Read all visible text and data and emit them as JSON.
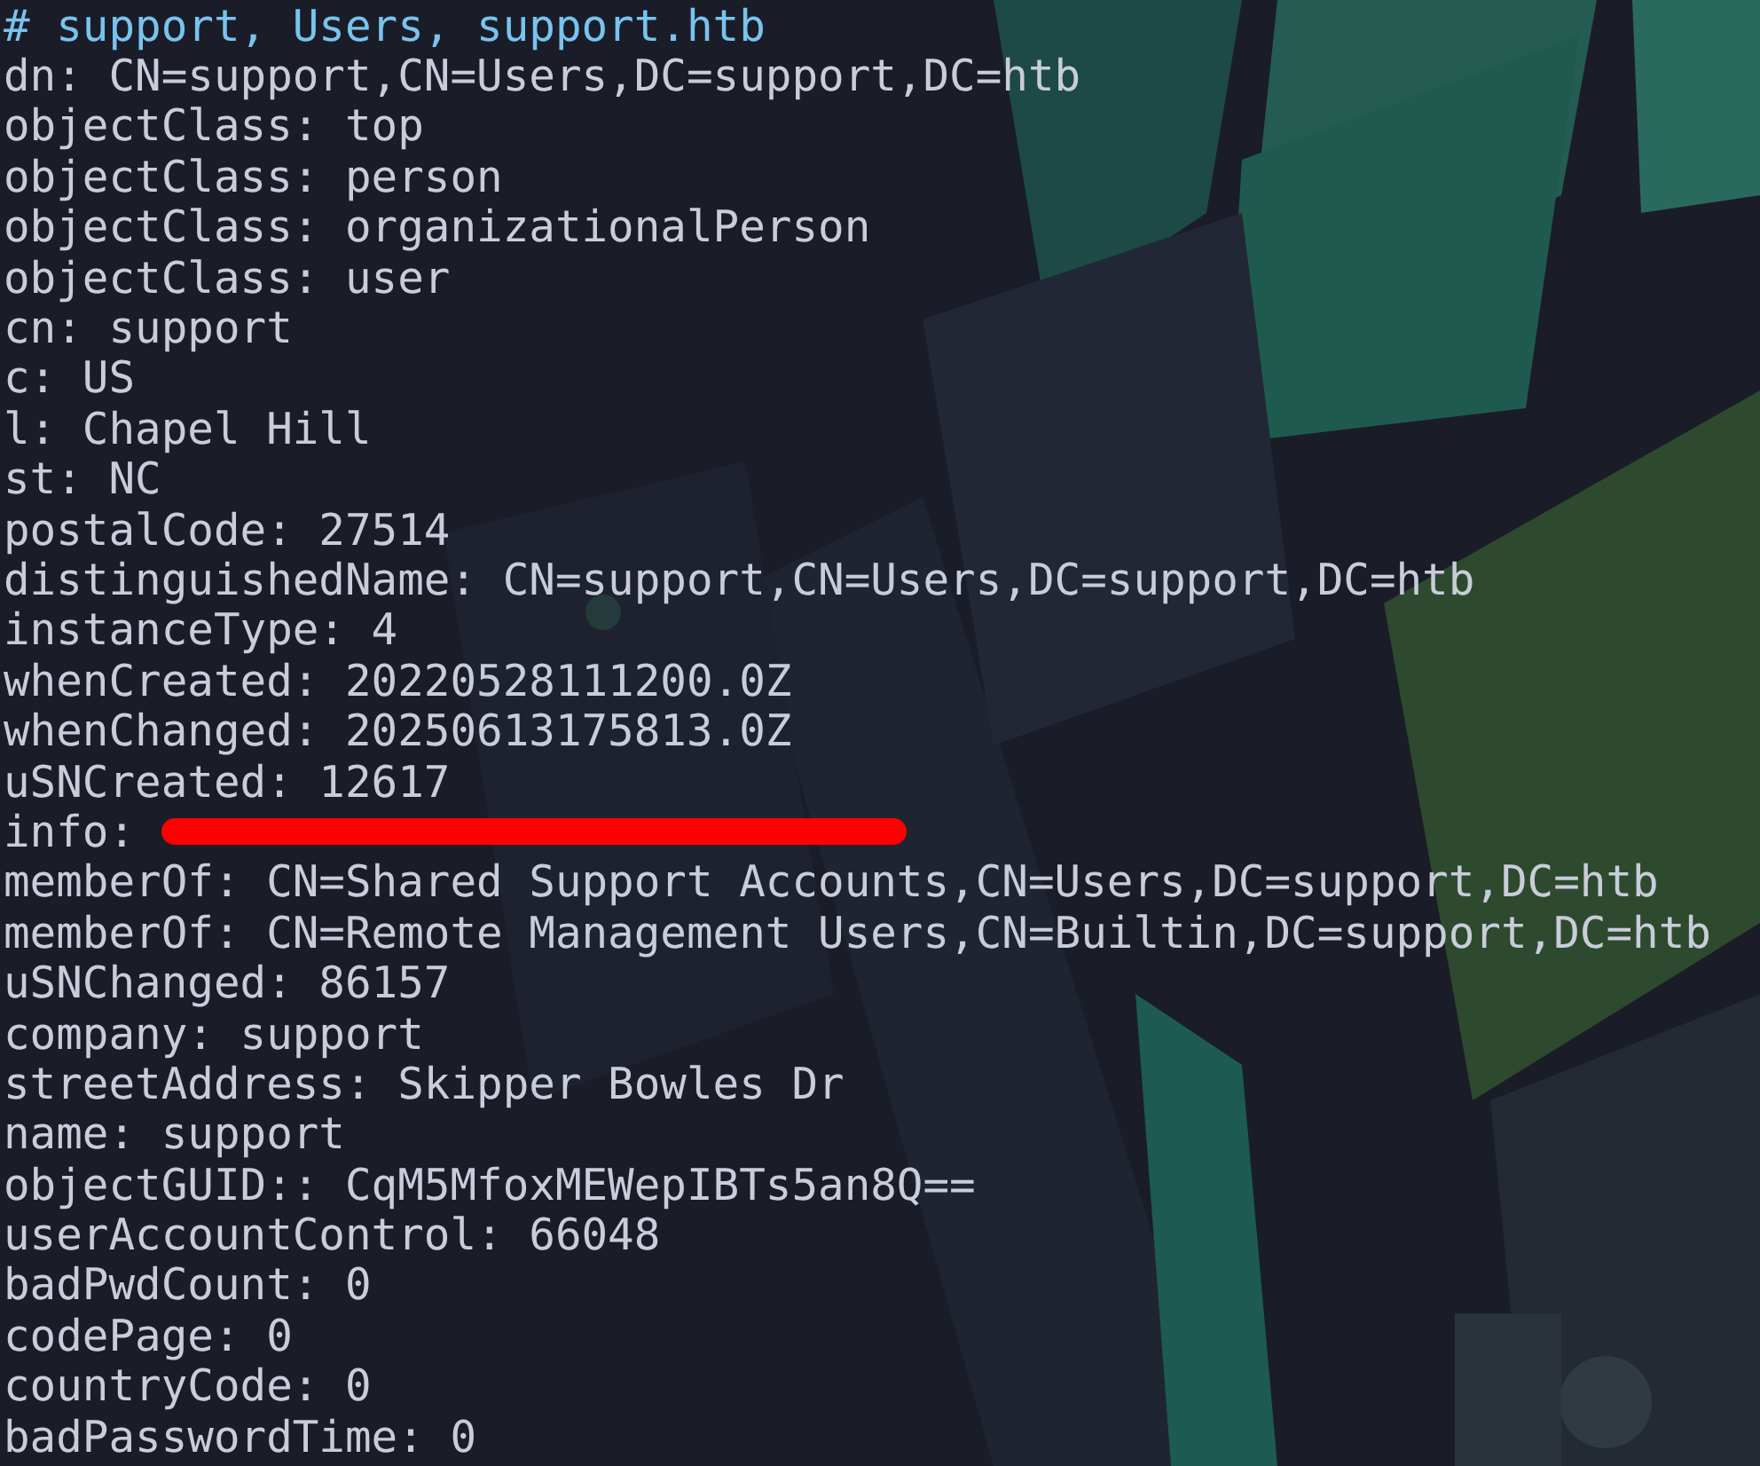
{
  "terminal": {
    "lines": [
      {
        "kind": "comment",
        "text": "# support, Users, support.htb"
      },
      {
        "kind": "attribute",
        "text": "dn: CN=support,CN=Users,DC=support,DC=htb"
      },
      {
        "kind": "attribute",
        "text": "objectClass: top"
      },
      {
        "kind": "attribute",
        "text": "objectClass: person"
      },
      {
        "kind": "attribute",
        "text": "objectClass: organizationalPerson"
      },
      {
        "kind": "attribute",
        "text": "objectClass: user"
      },
      {
        "kind": "attribute",
        "text": "cn: support"
      },
      {
        "kind": "attribute",
        "text": "c: US"
      },
      {
        "kind": "attribute",
        "text": "l: Chapel Hill"
      },
      {
        "kind": "attribute",
        "text": "st: NC"
      },
      {
        "kind": "attribute",
        "text": "postalCode: 27514"
      },
      {
        "kind": "attribute",
        "text": "distinguishedName: CN=support,CN=Users,DC=support,DC=htb"
      },
      {
        "kind": "attribute",
        "text": "instanceType: 4"
      },
      {
        "kind": "attribute",
        "text": "whenCreated: 20220528111200.0Z"
      },
      {
        "kind": "attribute",
        "text": "whenChanged: 20250613175813.0Z"
      },
      {
        "kind": "attribute",
        "text": "uSNCreated: 12617"
      },
      {
        "kind": "redacted",
        "text": "info:"
      },
      {
        "kind": "attribute",
        "text": "memberOf: CN=Shared Support Accounts,CN=Users,DC=support,DC=htb"
      },
      {
        "kind": "attribute",
        "text": "memberOf: CN=Remote Management Users,CN=Builtin,DC=support,DC=htb"
      },
      {
        "kind": "attribute",
        "text": "uSNChanged: 86157"
      },
      {
        "kind": "attribute",
        "text": "company: support"
      },
      {
        "kind": "attribute",
        "text": "streetAddress: Skipper Bowles Dr"
      },
      {
        "kind": "attribute",
        "text": "name: support"
      },
      {
        "kind": "attribute",
        "text": "objectGUID:: CqM5MfoxMEWepIBTs5an8Q=="
      },
      {
        "kind": "attribute",
        "text": "userAccountControl: 66048"
      },
      {
        "kind": "attribute",
        "text": "badPwdCount: 0"
      },
      {
        "kind": "attribute",
        "text": "codePage: 0"
      },
      {
        "kind": "attribute",
        "text": "countryCode: 0"
      },
      {
        "kind": "attribute",
        "text": "badPasswordTime: 0"
      }
    ]
  }
}
